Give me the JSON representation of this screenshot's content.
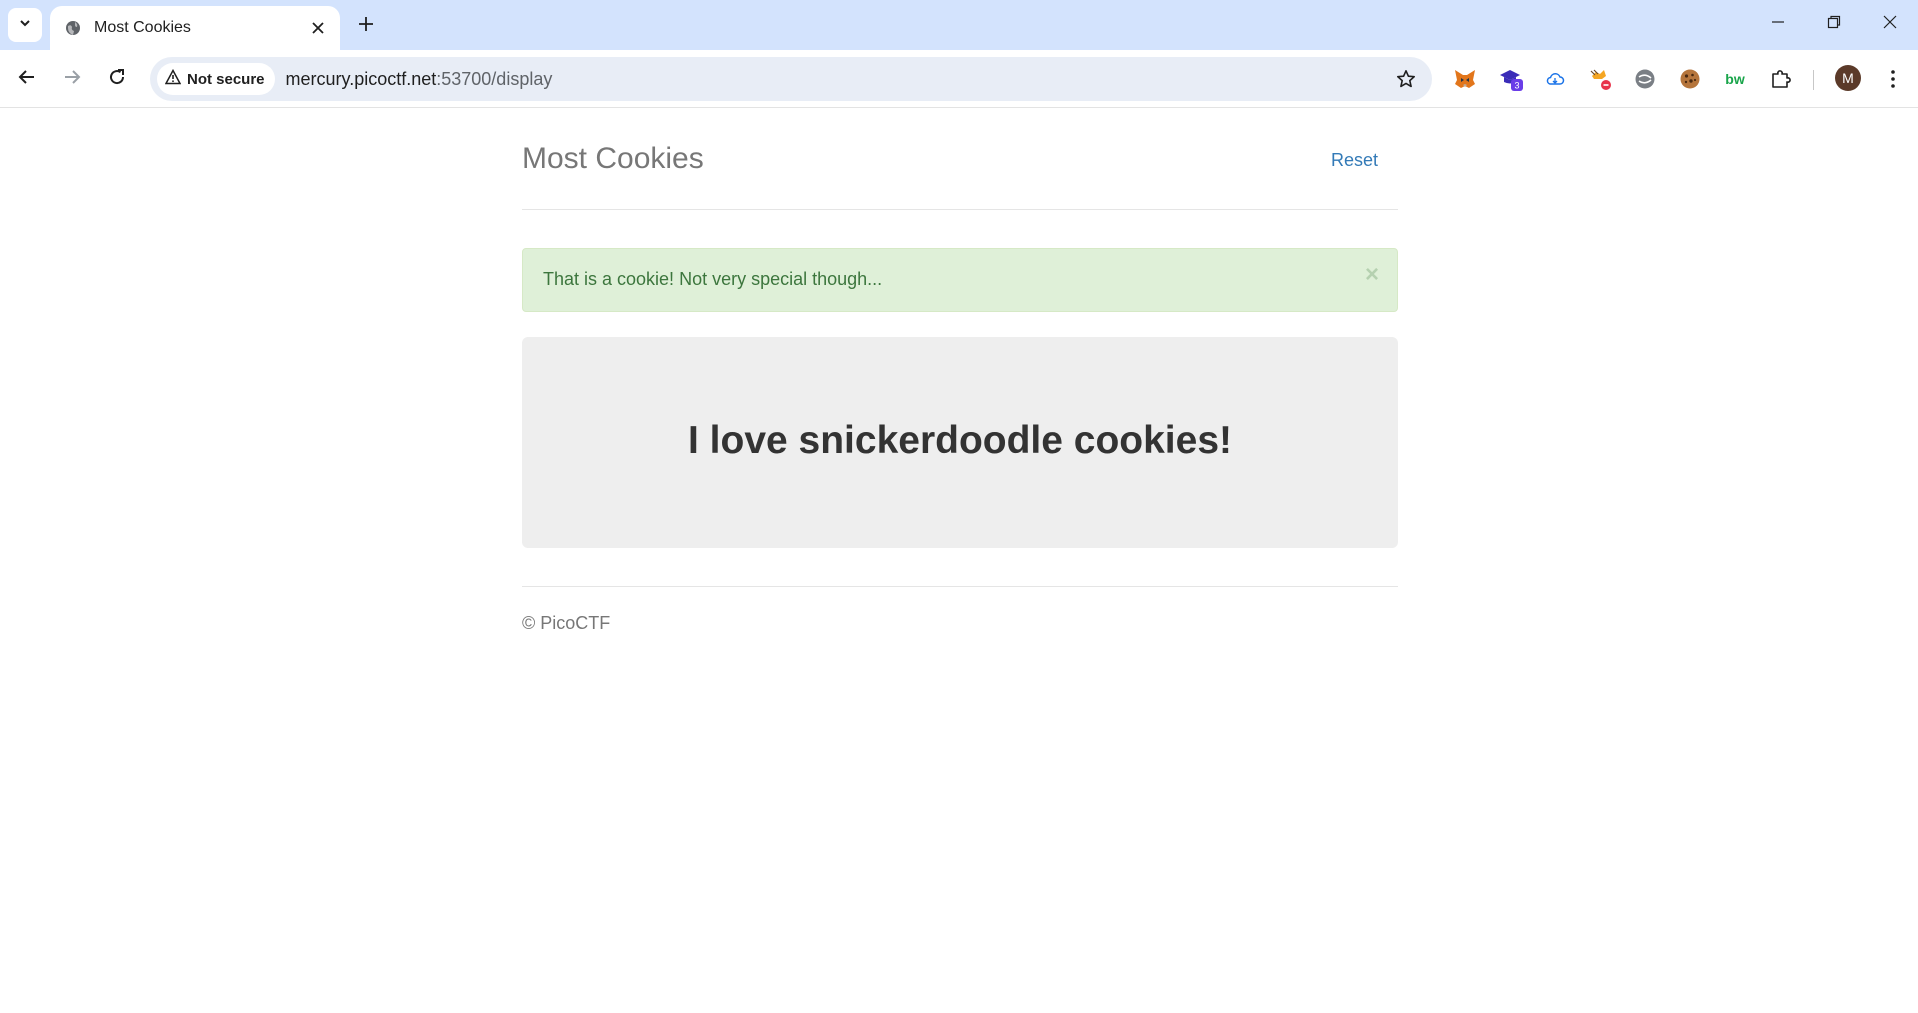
{
  "browser": {
    "tab_title": "Most Cookies",
    "security_label": "Not secure",
    "url_host": "mercury.picoctf.net",
    "url_path": ":53700/display",
    "extensions": [
      "metamask-icon",
      "graduation-cap-icon",
      "cloud-icon",
      "fox-block-icon",
      "grey-circle-icon",
      "cookie-icon",
      "bw-icon",
      "puzzle-icon"
    ],
    "extension_badge": "3",
    "extension_text_bw": "bw",
    "profile_initial": "M"
  },
  "page": {
    "brand": "Most Cookies",
    "reset_label": "Reset",
    "alert_message": "That is a cookie! Not very special though...",
    "alert_close": "×",
    "jumbotron_heading": "I love snickerdoodle cookies!",
    "footer_text": "© PicoCTF"
  },
  "colors": {
    "titlebar": "#d3e3fd",
    "link": "#337ab7",
    "alert_bg": "#dff0d8",
    "alert_text": "#3c763d",
    "jumbotron_bg": "#eeeeee"
  }
}
